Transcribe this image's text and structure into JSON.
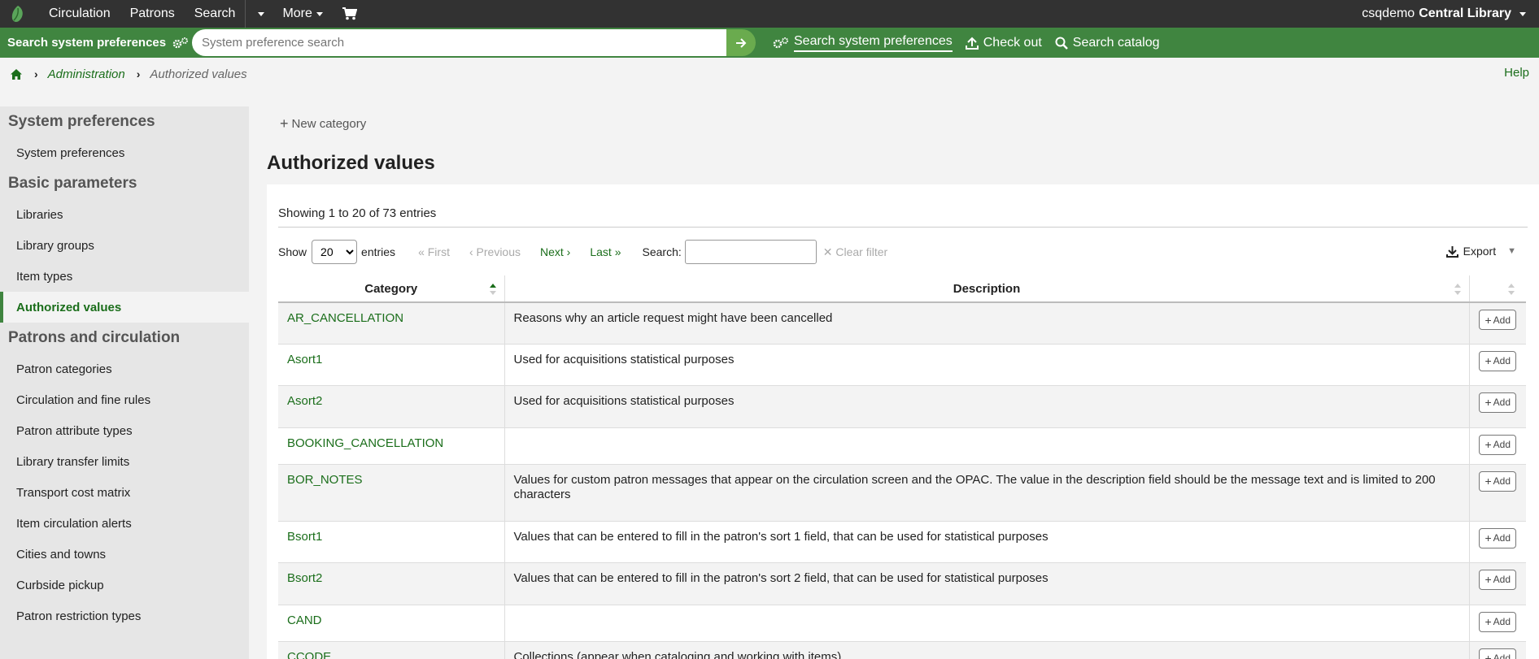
{
  "topnav": {
    "items": [
      "Circulation",
      "Patrons",
      "Search"
    ],
    "more_label": "More",
    "user": "csqdemo",
    "library": "Central Library"
  },
  "searchbar": {
    "label": "Search system preferences",
    "placeholder": "System preference search",
    "links": [
      "Search system preferences",
      "Check out",
      "Search catalog"
    ]
  },
  "breadcrumb": {
    "items": [
      "Administration",
      "Authorized values"
    ]
  },
  "help_label": "Help",
  "sidebar": {
    "sections": [
      {
        "heading": "System preferences",
        "items": [
          "System preferences"
        ]
      },
      {
        "heading": "Basic parameters",
        "items": [
          "Libraries",
          "Library groups",
          "Item types",
          "Authorized values"
        ]
      },
      {
        "heading": "Patrons and circulation",
        "items": [
          "Patron categories",
          "Circulation and fine rules",
          "Patron attribute types",
          "Library transfer limits",
          "Transport cost matrix",
          "Item circulation alerts",
          "Cities and towns",
          "Curbside pickup",
          "Patron restriction types"
        ]
      }
    ],
    "active_item": "Authorized values"
  },
  "main": {
    "new_category_label": "New category",
    "title": "Authorized values",
    "showing": "Showing 1 to 20 of 73 entries",
    "show_label": "Show",
    "page_size": "20",
    "entries_label": "entries",
    "pager": {
      "first": "First",
      "previous": "Previous",
      "next": "Next",
      "last": "Last"
    },
    "search_label": "Search:",
    "clear_filter_label": "Clear filter",
    "export_label": "Export",
    "columns": {
      "category": "Category",
      "description": "Description"
    },
    "add_label": "Add",
    "rows": [
      {
        "category": "AR_CANCELLATION",
        "description": "Reasons why an article request might have been cancelled"
      },
      {
        "category": "Asort1",
        "description": "Used for acquisitions statistical purposes"
      },
      {
        "category": "Asort2",
        "description": "Used for acquisitions statistical purposes"
      },
      {
        "category": "BOOKING_CANCELLATION",
        "description": ""
      },
      {
        "category": "BOR_NOTES",
        "description": "Values for custom patron messages that appear on the circulation screen and the OPAC. The value in the description field should be the message text and is limited to 200 characters"
      },
      {
        "category": "Bsort1",
        "description": "Values that can be entered to fill in the patron's sort 1 field, that can be used for statistical purposes"
      },
      {
        "category": "Bsort2",
        "description": "Values that can be entered to fill in the patron's sort 2 field, that can be used for statistical purposes"
      },
      {
        "category": "CAND",
        "description": ""
      },
      {
        "category": "CCODE",
        "description": "Collections (appear when cataloging and working with items)"
      }
    ]
  },
  "colors": {
    "topbar": "#323232",
    "green_bar": "#408540",
    "link_green": "#1b6e1b",
    "sidebar_bg": "#e6e6e6"
  }
}
